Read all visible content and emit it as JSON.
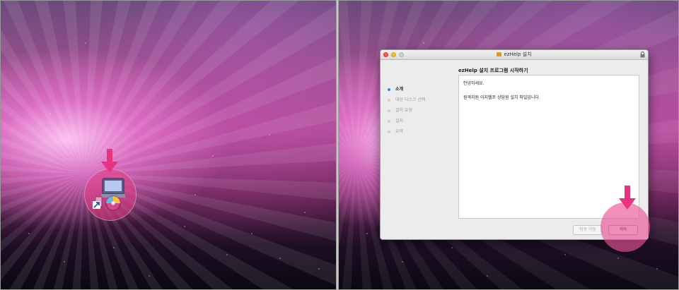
{
  "left_panel": {
    "icon": "installer-package-icon"
  },
  "right_panel": {
    "window": {
      "title": "ezHelp 설치",
      "heading": "ezHelp 설치 프로그램 시작하기",
      "steps": [
        {
          "label": "소개",
          "active": true
        },
        {
          "label": "대상 디스크 선택",
          "active": false
        },
        {
          "label": "설치 유형",
          "active": false
        },
        {
          "label": "설치",
          "active": false
        },
        {
          "label": "요약",
          "active": false
        }
      ],
      "body": {
        "greeting": "안녕하세요.",
        "description": "원격지원 이지헬프 상담원 설치 파일입니다."
      },
      "buttons": {
        "back": "뒤로 이동",
        "continue": "계속"
      }
    }
  },
  "colors": {
    "highlight": "#e23c82",
    "arrow": "#e8347e",
    "active_step_dot": "#2a8ef0"
  }
}
